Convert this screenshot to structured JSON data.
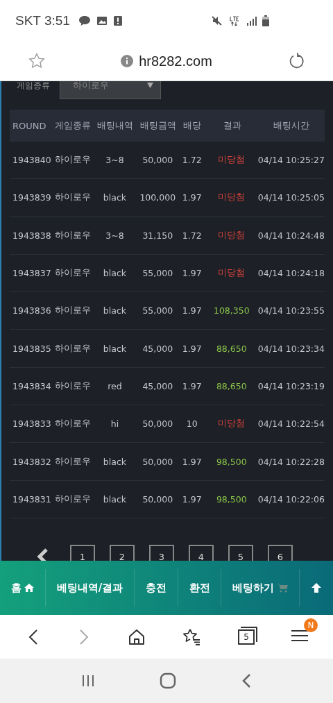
{
  "status_bar": {
    "carrier_time": "SKT 3:51"
  },
  "address_bar": {
    "url": "hr8282.com"
  },
  "filter": {
    "label": "게임종류",
    "value": "하이로우"
  },
  "table": {
    "columns": [
      "ROUND",
      "게임종류",
      "배팅내역",
      "배팅금액",
      "배당",
      "결과",
      "배팅시간"
    ],
    "rows": [
      {
        "round": "1943840",
        "game": "하이로우",
        "bet": "3~8",
        "amount": "50,000",
        "odds": "1.72",
        "result": "미당첨",
        "kind": "lose",
        "time": "04/14 10:25:27"
      },
      {
        "round": "1943839",
        "game": "하이로우",
        "bet": "black",
        "amount": "100,000",
        "odds": "1.97",
        "result": "미당첨",
        "kind": "lose",
        "time": "04/14 10:25:05"
      },
      {
        "round": "1943838",
        "game": "하이로우",
        "bet": "3~8",
        "amount": "31,150",
        "odds": "1.72",
        "result": "미당첨",
        "kind": "lose",
        "time": "04/14 10:24:48"
      },
      {
        "round": "1943837",
        "game": "하이로우",
        "bet": "black",
        "amount": "55,000",
        "odds": "1.97",
        "result": "미당첨",
        "kind": "lose",
        "time": "04/14 10:24:18"
      },
      {
        "round": "1943836",
        "game": "하이로우",
        "bet": "black",
        "amount": "55,000",
        "odds": "1.97",
        "result": "108,350",
        "kind": "win",
        "time": "04/14 10:23:55"
      },
      {
        "round": "1943835",
        "game": "하이로우",
        "bet": "black",
        "amount": "45,000",
        "odds": "1.97",
        "result": "88,650",
        "kind": "win",
        "time": "04/14 10:23:34"
      },
      {
        "round": "1943834",
        "game": "하이로우",
        "bet": "red",
        "amount": "45,000",
        "odds": "1.97",
        "result": "88,650",
        "kind": "win",
        "time": "04/14 10:23:19"
      },
      {
        "round": "1943833",
        "game": "하이로우",
        "bet": "hi",
        "amount": "50,000",
        "odds": "10",
        "result": "미당첨",
        "kind": "lose",
        "time": "04/14 10:22:54"
      },
      {
        "round": "1943832",
        "game": "하이로우",
        "bet": "black",
        "amount": "50,000",
        "odds": "1.97",
        "result": "98,500",
        "kind": "win",
        "time": "04/14 10:22:28"
      },
      {
        "round": "1943831",
        "game": "하이로우",
        "bet": "black",
        "amount": "50,000",
        "odds": "1.97",
        "result": "98,500",
        "kind": "win",
        "time": "04/14 10:22:06"
      }
    ]
  },
  "pagination": {
    "pages": [
      "1",
      "2",
      "3",
      "4",
      "5",
      "6"
    ]
  },
  "bottom_nav": [
    {
      "label": "홈",
      "kind": "home"
    },
    {
      "label": "베팅내역/결과",
      "kind": "text"
    },
    {
      "label": "충전",
      "kind": "text"
    },
    {
      "label": "환전",
      "kind": "text"
    },
    {
      "label": "베팅하기",
      "kind": "cart"
    },
    {
      "kind": "top"
    }
  ],
  "browser_toolbar": {
    "tabs_count": "5",
    "menu_badge": "N"
  }
}
